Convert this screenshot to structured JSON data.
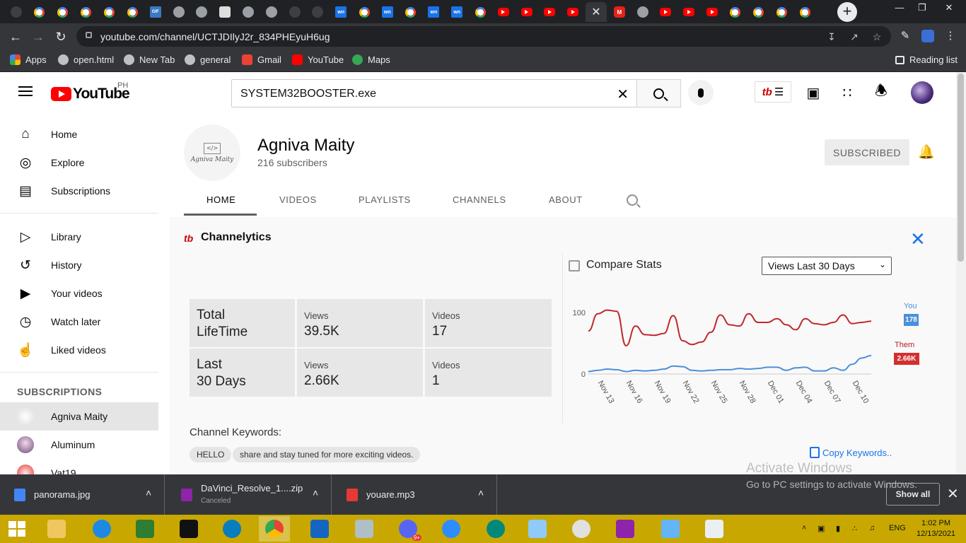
{
  "browser": {
    "url": "youtube.com/channel/UCTJDIlyJ2r_834PHEyuH6ug",
    "tab_icons": [
      "system-icon",
      "google-icon",
      "google-icon",
      "google-icon",
      "google-icon",
      "google-icon",
      "gif-icon",
      "globe-icon",
      "globe-icon",
      "notion-icon",
      "globe-icon",
      "globe-icon",
      "github-icon",
      "github-icon",
      "webnovel-icon",
      "google-icon",
      "webnovel-icon",
      "google-icon",
      "webnovel-icon",
      "webnovel-icon",
      "google-icon",
      "youtube-icon",
      "youtube-icon",
      "youtube-icon",
      "youtube-icon",
      "close-icon",
      "m-icon",
      "globe-icon",
      "youtube-icon",
      "youtube-icon",
      "youtube-icon",
      "google-icon",
      "google-icon",
      "google-icon",
      "google-icon"
    ],
    "tab_gif_label": "GIF",
    "tab_wn_label": "wn",
    "tab_m_label": "M",
    "bookmarks": [
      {
        "label": "Apps",
        "icon": "apps-grid-icon"
      },
      {
        "label": "open.html",
        "icon": "globe-icon"
      },
      {
        "label": "New Tab",
        "icon": "globe-icon"
      },
      {
        "label": "general",
        "icon": "globe-icon"
      },
      {
        "label": "Gmail",
        "icon": "gmail-icon"
      },
      {
        "label": "YouTube",
        "icon": "youtube-icon"
      },
      {
        "label": "Maps",
        "icon": "maps-icon"
      }
    ],
    "reading_list": "Reading list"
  },
  "youtube": {
    "logo_text": "YouTube",
    "country_code": "PH",
    "search_value": "SYSTEM32BOOSTER.exe",
    "tubebuddy_logo": "tb"
  },
  "sidebar": {
    "primary": [
      {
        "label": "Home",
        "icon": "home-icon"
      },
      {
        "label": "Explore",
        "icon": "compass-icon"
      },
      {
        "label": "Subscriptions",
        "icon": "subscriptions-icon"
      }
    ],
    "secondary": [
      {
        "label": "Library",
        "icon": "library-icon"
      },
      {
        "label": "History",
        "icon": "history-icon"
      },
      {
        "label": "Your videos",
        "icon": "your-videos-icon"
      },
      {
        "label": "Watch later",
        "icon": "clock-icon"
      },
      {
        "label": "Liked videos",
        "icon": "thumbs-up-icon"
      }
    ],
    "subscriptions_header": "SUBSCRIPTIONS",
    "subscriptions": [
      {
        "label": "Agniva Maity",
        "selected": true
      },
      {
        "label": "Aluminum",
        "selected": false
      },
      {
        "label": "Vat19",
        "selected": false
      }
    ]
  },
  "channel": {
    "avatar_label": "Agniva Maity",
    "avatar_code": "</>",
    "name": "Agniva Maity",
    "subscribers": "216 subscribers",
    "subscribe_label": "SUBSCRIBED",
    "tabs": [
      "HOME",
      "VIDEOS",
      "PLAYLISTS",
      "CHANNELS",
      "ABOUT"
    ],
    "active_tab": "HOME"
  },
  "channelytics": {
    "title": "Channelytics",
    "stats": [
      {
        "period_line1": "Total",
        "period_line2": "LifeTime",
        "views_label": "Views",
        "views": "39.5K",
        "videos_label": "Videos",
        "videos": "17"
      },
      {
        "period_line1": "Last",
        "period_line2": "30 Days",
        "views_label": "Views",
        "views": "2.66K",
        "videos_label": "Videos",
        "videos": "1"
      }
    ],
    "compare_title": "Compare Stats",
    "compare_select": "Views Last 30 Days",
    "legend_you_label": "You",
    "legend_you_value": "178",
    "legend_them_label": "Them",
    "legend_them_value": "2.66K",
    "keywords_title": "Channel Keywords:",
    "keywords": [
      "HELLO",
      "share and stay tuned for more exciting videos."
    ],
    "copy_keywords": "Copy Keywords.."
  },
  "chart_data": {
    "type": "line",
    "x": [
      "Nov 12",
      "Nov 13",
      "Nov 14",
      "Nov 15",
      "Nov 16",
      "Nov 17",
      "Nov 18",
      "Nov 19",
      "Nov 20",
      "Nov 21",
      "Nov 22",
      "Nov 23",
      "Nov 24",
      "Nov 25",
      "Nov 26",
      "Nov 27",
      "Nov 28",
      "Nov 29",
      "Nov 30",
      "Dec 01",
      "Dec 02",
      "Dec 03",
      "Dec 04",
      "Dec 05",
      "Dec 06",
      "Dec 07",
      "Dec 08",
      "Dec 09",
      "Dec 10",
      "Dec 11",
      "Dec 12"
    ],
    "x_tick_labels": [
      "Nov 13",
      "Nov 16",
      "Nov 19",
      "Nov 22",
      "Nov 25",
      "Nov 28",
      "Dec 01",
      "Dec 04",
      "Dec 07",
      "Dec 10"
    ],
    "y_ticks": [
      0,
      100
    ],
    "ylim": [
      0,
      115
    ],
    "series": [
      {
        "name": "Them",
        "color": "#c0282d",
        "values": [
          70,
          98,
          104,
          102,
          46,
          78,
          64,
          63,
          66,
          95,
          54,
          48,
          52,
          68,
          96,
          80,
          78,
          98,
          84,
          84,
          90,
          80,
          72,
          90,
          82,
          80,
          84,
          96,
          82,
          84,
          86
        ]
      },
      {
        "name": "You",
        "color": "#4a90d9",
        "values": [
          4,
          6,
          8,
          7,
          4,
          6,
          5,
          6,
          8,
          13,
          12,
          6,
          5,
          6,
          7,
          7,
          9,
          8,
          9,
          11,
          11,
          6,
          10,
          11,
          5,
          5,
          10,
          6,
          16,
          26,
          30
        ]
      }
    ],
    "legend": "right"
  },
  "downloads": [
    {
      "name": "panorama.jpg",
      "sub": "",
      "icon": "image-file-icon"
    },
    {
      "name": "DaVinci_Resolve_1....zip",
      "sub": "Canceled",
      "icon": "winrar-icon"
    },
    {
      "name": "youare.mp3",
      "sub": "",
      "icon": "headphones-icon"
    }
  ],
  "downloads_show_all": "Show all",
  "windows_watermark": {
    "line1": "Activate Windows",
    "line2": "Go to PC settings to activate Windows."
  },
  "taskbar": {
    "language": "ENG",
    "time": "1:02 PM",
    "date": "12/13/2021",
    "discord_badge": "9+"
  }
}
